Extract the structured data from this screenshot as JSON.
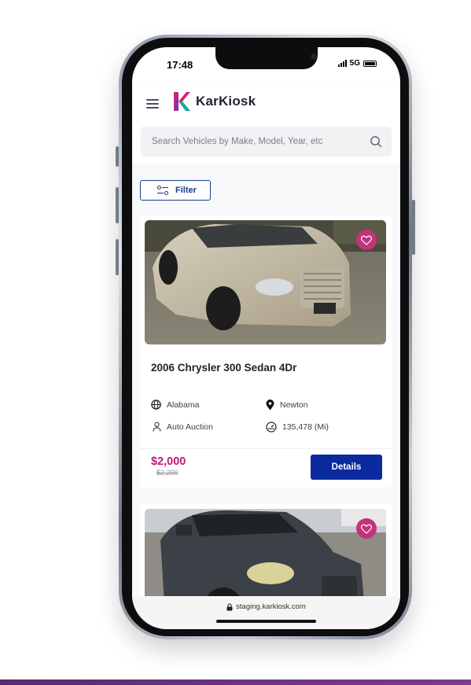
{
  "status_bar": {
    "time": "17:48",
    "network": "5G"
  },
  "header": {
    "brand": "KarKiosk",
    "search_placeholder": "Search Vehicles by Make, Model, Year, etc"
  },
  "filter": {
    "label": "Filter"
  },
  "listings": [
    {
      "title": "2006 Chrysler 300 Sedan 4Dr",
      "state": "Alabama",
      "city": "Newton",
      "seller": "Auto Auction",
      "mileage": "135,478 (Mi)",
      "price": "$2,000",
      "old_price": "$2,200",
      "details_label": "Details"
    },
    {
      "title": ""
    }
  ],
  "browser": {
    "url": "staging.karkiosk.com"
  },
  "colors": {
    "brand_blue": "#0a2a9e",
    "accent_pink": "#c2187a",
    "logo_pink": "#e0207a",
    "logo_teal": "#1aa8a0"
  },
  "icons": [
    "menu-icon",
    "karkiosk-logo-icon",
    "search-icon",
    "filter-icon",
    "heart-icon",
    "globe-icon",
    "location-pin-icon",
    "person-icon",
    "speedometer-icon",
    "lock-icon"
  ]
}
